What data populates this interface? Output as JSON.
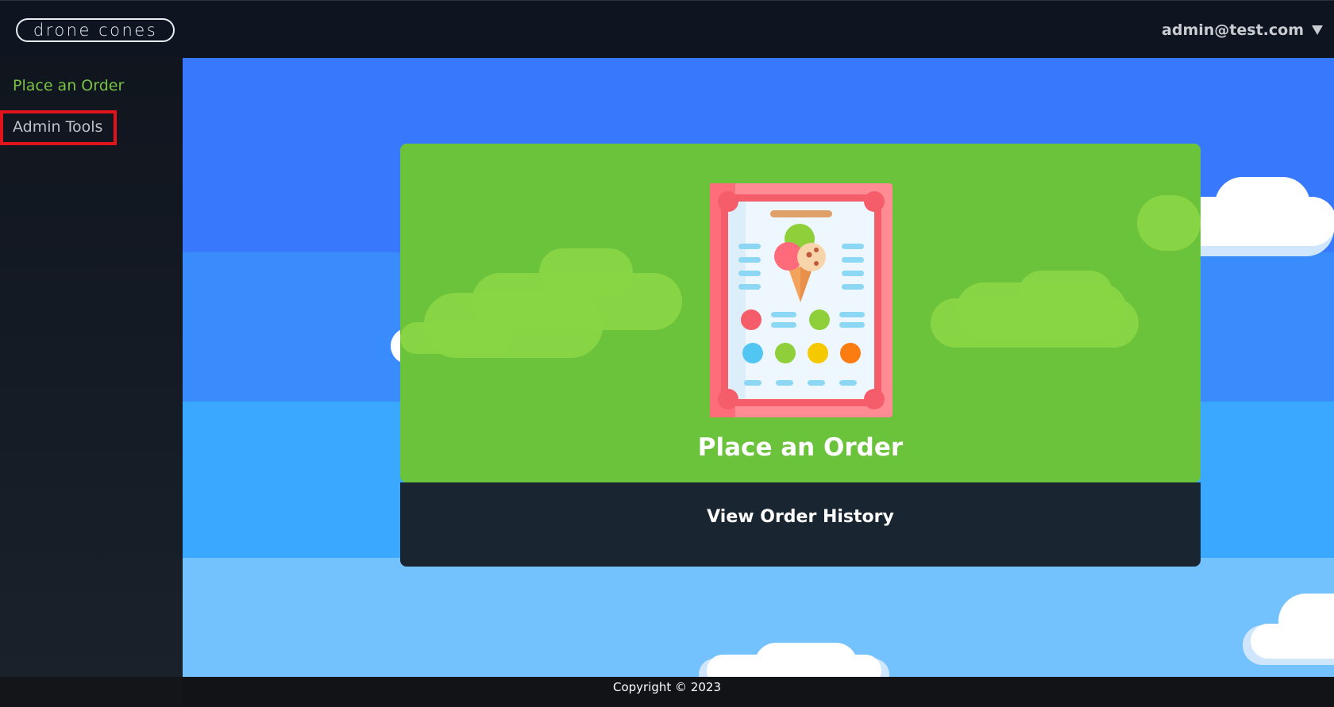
{
  "header": {
    "logo_text": "drone cones",
    "user_email": "admin@test.com"
  },
  "sidebar": {
    "items": [
      {
        "label": "Place an Order",
        "active": true
      },
      {
        "label": "Admin Tools",
        "active": false
      }
    ]
  },
  "main": {
    "place_order_label": "Place an Order",
    "view_history_label": "View Order History"
  },
  "footer": {
    "copyright": "Copyright © 2023"
  },
  "colors": {
    "accent_green": "#6bc23b",
    "dark_card": "#1a2532",
    "sky_blue": "#3878fc",
    "highlight_red": "#e0141a"
  },
  "icons": [
    "chevron-down-icon",
    "ice-cream-menu-illustration"
  ]
}
